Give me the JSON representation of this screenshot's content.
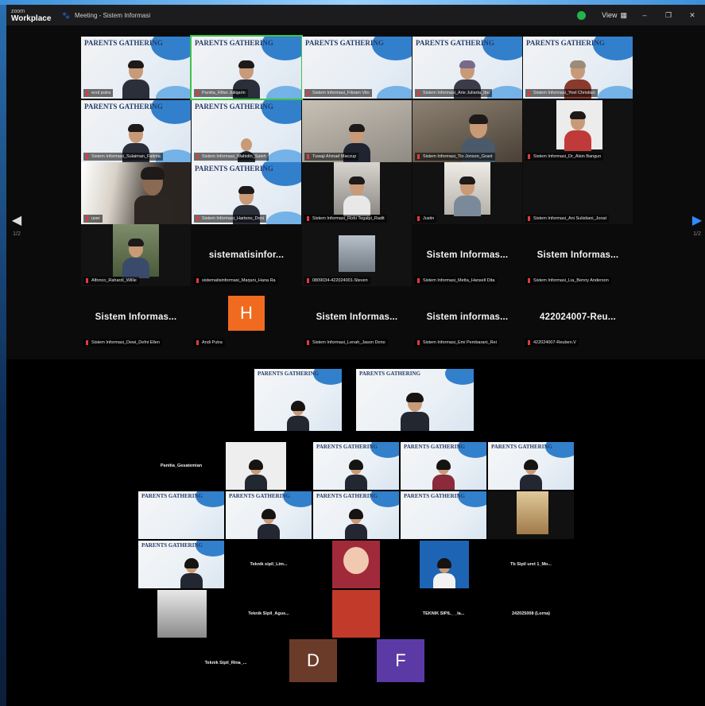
{
  "titlebar": {
    "brand_top": "zoom",
    "brand_bottom": "Workplace",
    "meeting_title": "Meeting - Sistem Informasi",
    "view_label": "View",
    "minimize": "–",
    "maximize": "❐",
    "close": "✕"
  },
  "gallery": {
    "slide_logo": "PARENTS GATHERING",
    "tiles": [
      {
        "name": "ersil putra"
      },
      {
        "name": "Panitia_Rifan Juliqarin"
      },
      {
        "name": "Sistem Informasi_Fikram Vito"
      },
      {
        "name": "Sistem Informasi_Arie Juliarta_Ibu"
      },
      {
        "name": "Sistem Informasi_Yoel Christian"
      },
      {
        "name": "Sistem Informasi_Sulaiman_Fatima"
      },
      {
        "name": "Sistem Informasi_Wahidin_Saleh"
      },
      {
        "name": "Tuwaji Ahmad Maczup"
      },
      {
        "name": "Sistem Informasi_Tio Jonson_Grant"
      },
      {
        "name": "Sistem Informasi_Dr_Alsin Bangun"
      },
      {
        "name": "user"
      },
      {
        "name": "Sistem Informasi_Hartono_Doni"
      },
      {
        "name": "Sistem Informasi_Rizki Tegalpi_Radit"
      },
      {
        "name": "Justin"
      },
      {
        "name": "Sistem Informasi_Ani Sulistiani_Jonat"
      },
      {
        "name": "Alfonco_Rahardi_Willie"
      },
      {
        "name": "sistematisinformasi_Marjani_Hana Ra"
      },
      {
        "name": "0809034-422024001-Steven"
      },
      {
        "name": "Sistem Informasi_Metta_Hansell Dita"
      },
      {
        "name": "Sistem Informasi_Lia_Benny Anderson"
      },
      {
        "name": "Sistem Informasi_Dewi_Defni Ellen"
      },
      {
        "name": "Andi Putra"
      },
      {
        "name": "Sistem Informasi_Lenah_Jason Dono"
      },
      {
        "name": "Sistem Informasi_Emi Pembarani_Rei"
      },
      {
        "name": "422024007-Reuben.V"
      }
    ],
    "text_tiles": [
      "sistematisinfor...",
      "Sistem Informas...",
      "Sistem Informas...",
      "Sistem Informas...",
      "Sistem Informas...",
      "Sistem informas...",
      "422024007-Reu..."
    ],
    "avatar_h": "H",
    "page_left": "1/2",
    "page_right": "1/2"
  },
  "room": {
    "slide_logo": "PARENTS GATHERING",
    "text_tiles": [
      "Panitia_Gesatemian",
      "Teknik sipil_Lim...",
      "Tb Sipil uret 1_Mo...",
      "Teknik Sipil_Agus...",
      "TEKNIK SIPIL_ _la...",
      "242025008 (Lorna)",
      "Teknik Sipil_Rina_..."
    ],
    "avatar_d": "D",
    "avatar_f": "F",
    "colors": {
      "avatar_h": "#f06b1f",
      "avatar_d": "#6b3b2a",
      "avatar_f": "#5b3aa6"
    }
  }
}
